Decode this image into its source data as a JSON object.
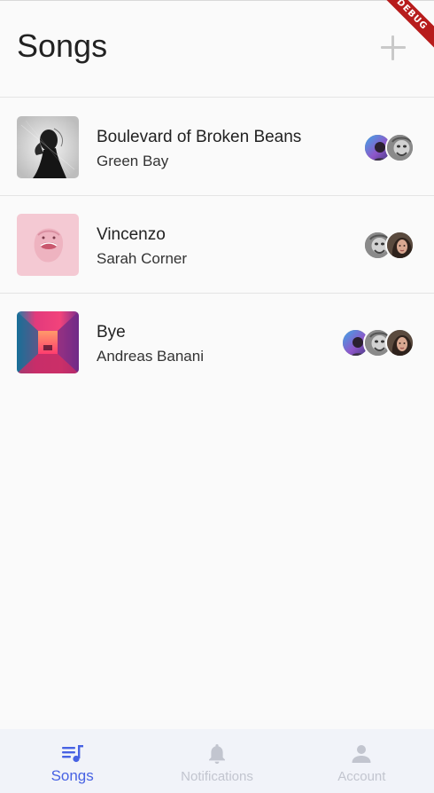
{
  "debug_banner": "DEBUG",
  "header": {
    "title": "Songs",
    "add_icon": "plus-icon"
  },
  "songs": [
    {
      "title": "Boulevard of Broken Beans",
      "artist": "Green Bay",
      "cover": "bw-portrait-cover",
      "listeners": 2
    },
    {
      "title": "Vincenzo",
      "artist": "Sarah Corner",
      "cover": "pink-face-cover",
      "listeners": 2
    },
    {
      "title": "Bye",
      "artist": "Andreas Banani",
      "cover": "neon-corridor-cover",
      "listeners": 3
    }
  ],
  "bottom_nav": {
    "items": [
      {
        "label": "Songs",
        "icon": "playlist-icon",
        "active": true
      },
      {
        "label": "Notifications",
        "icon": "bell-icon",
        "active": false
      },
      {
        "label": "Account",
        "icon": "person-icon",
        "active": false
      }
    ]
  },
  "colors": {
    "accent": "#4762e3",
    "inactive": "#c2c5cf",
    "nav_background": "#f1f3f9",
    "background": "#fafafa"
  }
}
